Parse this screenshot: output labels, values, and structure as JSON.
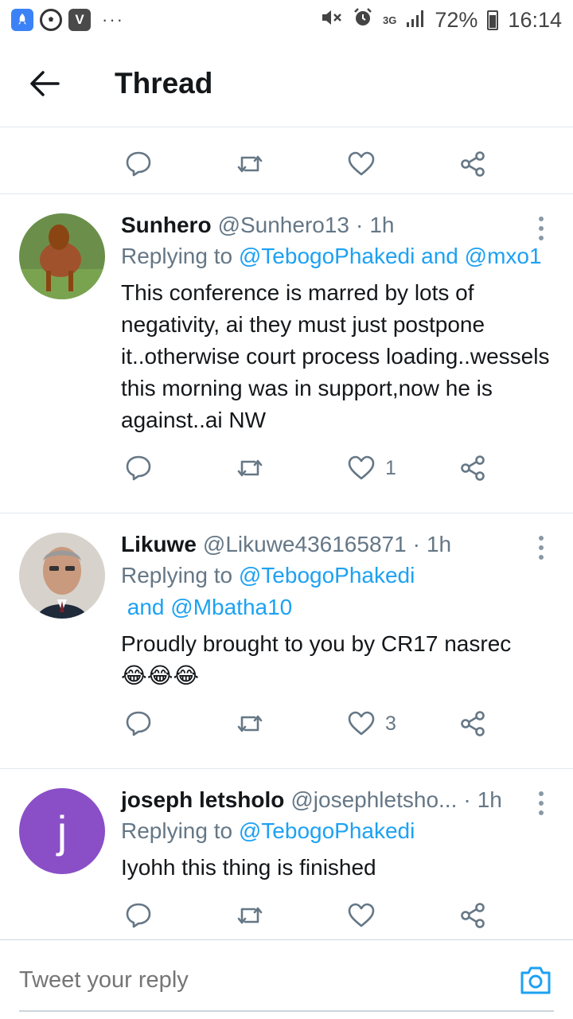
{
  "status_bar": {
    "left_icons": [
      "rocket-app-icon",
      "soccer-ball-icon",
      "v-app-icon",
      "more-notifications-icon"
    ],
    "network": "3G",
    "battery": "72%",
    "time": "16:14",
    "icons": [
      "mute-icon",
      "alarm-icon",
      "signal-icon",
      "battery-icon"
    ]
  },
  "header": {
    "title": "Thread",
    "back_icon": "arrow-left-icon"
  },
  "colors": {
    "accent": "#1da1f2",
    "text_primary": "#14171a",
    "text_secondary": "#657786",
    "divider": "#e1e8ed"
  },
  "tweets": [
    {
      "name": "Sunhero",
      "handle": "@Sunhero13",
      "separator": "·",
      "time": "1h",
      "replying_prefix": "Replying to ",
      "mention_1": "@TebogoPhakedi",
      "mention_joiner": " and ",
      "mention_2": "@mxo1",
      "text": "This conference is marred by lots of negativity, ai they must just postpone it..otherwise court process loading..wessels this morning was in support,now he is against..ai NW",
      "likes": "1"
    },
    {
      "name": "Likuwe",
      "handle": "@Likuwe436165871",
      "separator": "·",
      "time": "1h",
      "replying_prefix": "Replying to ",
      "mention_1": "@TebogoPhakedi",
      "mention_joiner": " and ",
      "mention_2": "@Mbatha10",
      "text": "Proudly brought to you by CR17 nasrec",
      "emoji": "😂😂😂",
      "likes": "3"
    },
    {
      "name": "joseph letsholo",
      "handle": "@josephletsho...",
      "separator": "·",
      "time": "1h",
      "avatar_letter": "j",
      "avatar_color": "#8a4fc7",
      "replying_prefix": "Replying to ",
      "mention_1": "@TebogoPhakedi",
      "text": "Iyohh this thing is finished"
    }
  ],
  "reply_bar": {
    "placeholder": "Tweet your reply",
    "camera_icon": "camera-icon"
  }
}
